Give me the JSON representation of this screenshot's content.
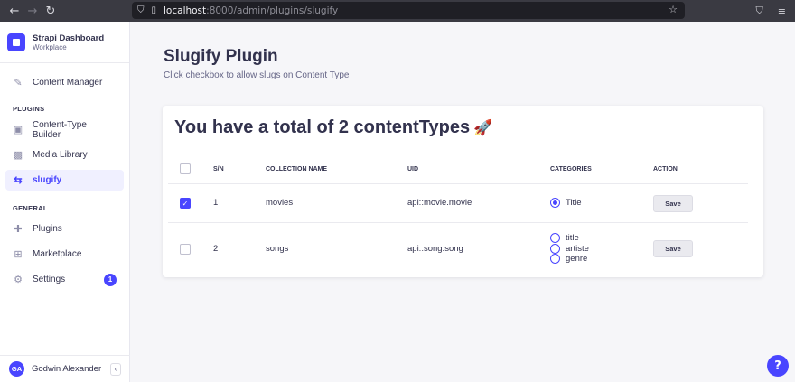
{
  "browser": {
    "url_host": "localhost",
    "url_rest": ":8000/admin/plugins/slugify"
  },
  "sidebar": {
    "brand_title": "Strapi Dashboard",
    "brand_sub": "Workplace",
    "content_manager": "Content Manager",
    "plugins_label": "PLUGINS",
    "plugins_items": [
      "Content-Type Builder",
      "Media Library",
      "slugify"
    ],
    "general_label": "GENERAL",
    "general_items": [
      "Plugins",
      "Marketplace",
      "Settings"
    ],
    "settings_badge": "1",
    "user_initials": "GA",
    "user_name": "Godwin Alexander"
  },
  "main": {
    "title": "Slugify Plugin",
    "subtitle": "Click checkbox to allow slugs on Content Type",
    "card_title": "You have a total of 2 contentTypes",
    "card_emoji": "🚀",
    "columns": [
      "S/N",
      "COLLECTION NAME",
      "UID",
      "CATEGORIES",
      "ACTION"
    ],
    "rows": [
      {
        "sn": "1",
        "name": "movies",
        "uid": "api::movie.movie",
        "checked": true,
        "categories": [
          "Title"
        ],
        "selected": "Title",
        "action": "Save"
      },
      {
        "sn": "2",
        "name": "songs",
        "uid": "api::song.song",
        "checked": false,
        "categories": [
          "title",
          "artiste",
          "genre"
        ],
        "selected": "",
        "action": "Save"
      }
    ]
  },
  "help_label": "?",
  "colors": {
    "accent": "#4945ff",
    "sidebar_active_bg": "#f0f0ff",
    "page_bg": "#f6f6f9"
  }
}
